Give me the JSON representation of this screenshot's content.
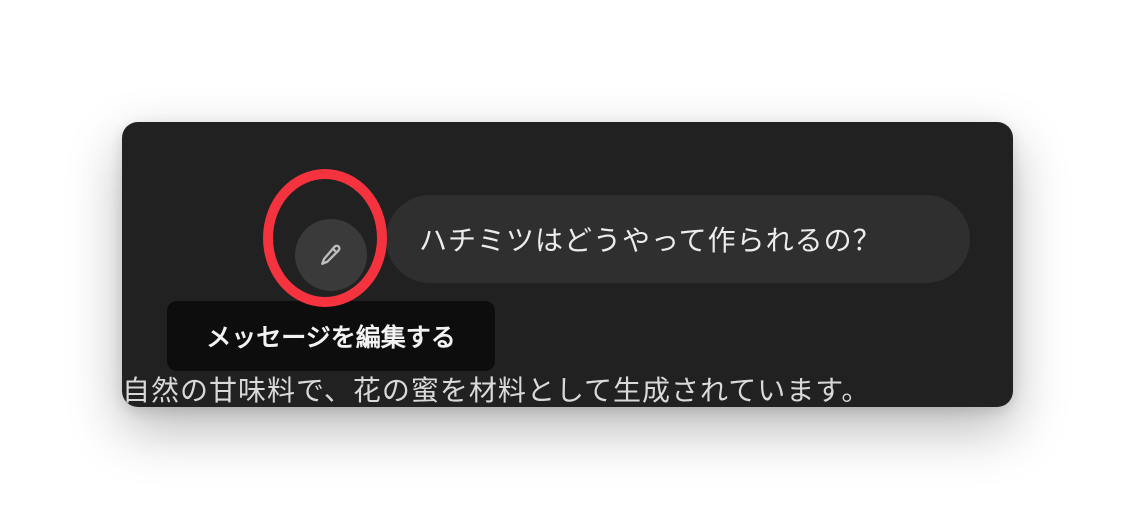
{
  "conversation": {
    "user_message": "ハチミツはどうやって作られるの？",
    "assistant_reply": "自然の甘味料で、花の蜜を材料として生成されています。"
  },
  "edit_button": {
    "icon": "pencil-icon",
    "tooltip": "メッセージを編集する"
  },
  "colors": {
    "card_background": "#212121",
    "bubble_background": "#2f2f2f",
    "highlight_ring": "#f5333f",
    "tooltip_background": "#0d0d0d"
  }
}
